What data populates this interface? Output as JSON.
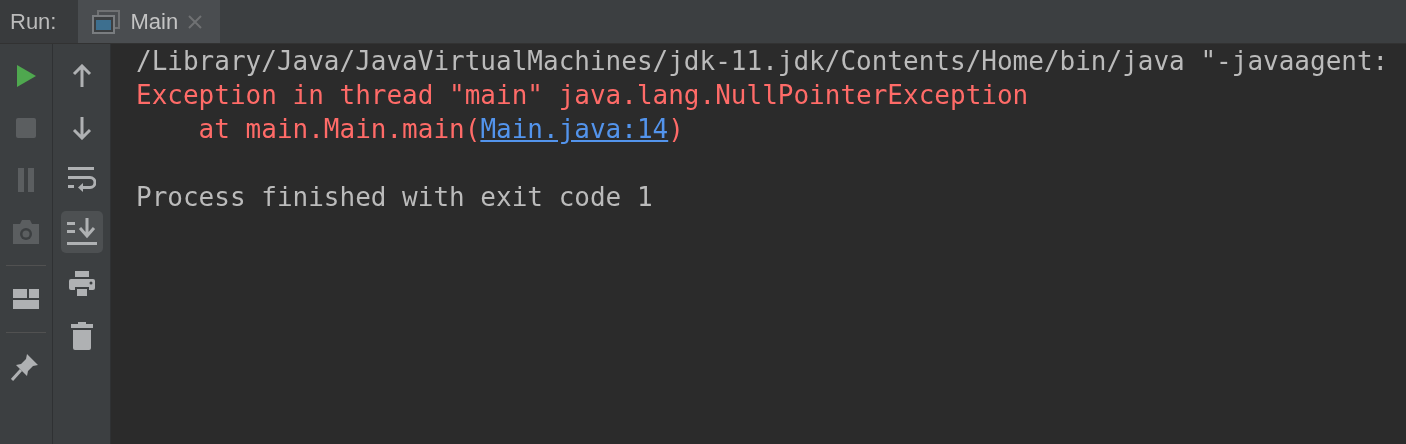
{
  "header": {
    "label": "Run:",
    "tabs": [
      {
        "title": "Main",
        "selected": true
      }
    ]
  },
  "left_toolbar": [
    {
      "kind": "run",
      "disabled": false
    },
    {
      "kind": "stop",
      "disabled": true
    },
    {
      "kind": "pause",
      "disabled": true
    },
    {
      "kind": "camera",
      "disabled": true
    },
    {
      "kind": "separator"
    },
    {
      "kind": "layout",
      "disabled": false
    },
    {
      "kind": "separator"
    },
    {
      "kind": "pin",
      "disabled": false
    }
  ],
  "right_toolbar": [
    {
      "kind": "up",
      "on": false
    },
    {
      "kind": "down",
      "on": false
    },
    {
      "kind": "wrap",
      "on": false
    },
    {
      "kind": "scroll-end",
      "on": true
    },
    {
      "kind": "print",
      "on": false
    },
    {
      "kind": "trash",
      "on": false
    }
  ],
  "console": [
    {
      "kind": "normal",
      "parts": [
        {
          "kind": "text",
          "text": "/Library/Java/JavaVirtualMachines/jdk-11.jdk/Contents/Home/bin/java \"-javaagent:"
        }
      ]
    },
    {
      "kind": "error",
      "parts": [
        {
          "kind": "text",
          "text": "Exception in thread \"main\" java.lang.NullPointerException"
        }
      ]
    },
    {
      "kind": "error",
      "parts": [
        {
          "kind": "text",
          "text": "    at main.Main.main("
        },
        {
          "kind": "link",
          "text": "Main.java:14"
        },
        {
          "kind": "text",
          "text": ")"
        }
      ]
    },
    {
      "kind": "blank"
    },
    {
      "kind": "normal",
      "parts": [
        {
          "kind": "text",
          "text": "Process finished with exit code 1"
        }
      ]
    }
  ]
}
